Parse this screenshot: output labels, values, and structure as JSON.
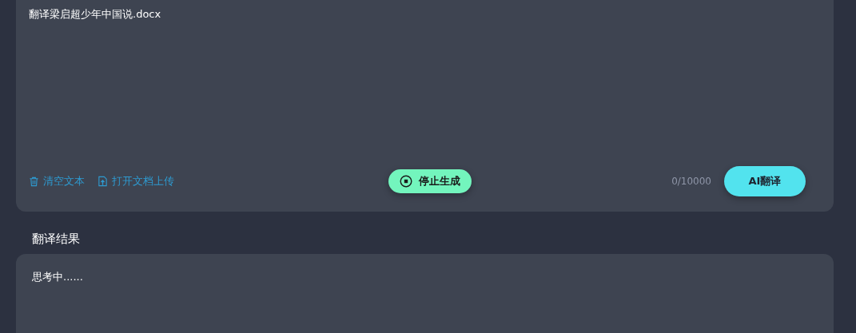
{
  "input": {
    "value": "翻译梁启超少年中国说.docx"
  },
  "toolbar": {
    "actions": [
      {
        "kind": "clear",
        "label": "清空文本"
      },
      {
        "kind": "upload",
        "label": "打开文档上传"
      }
    ],
    "stop_button": "停止生成",
    "char_count": "0/10000",
    "translate_button": "AI翻译"
  },
  "result": {
    "title": "翻译结果",
    "text": "思考中......"
  }
}
